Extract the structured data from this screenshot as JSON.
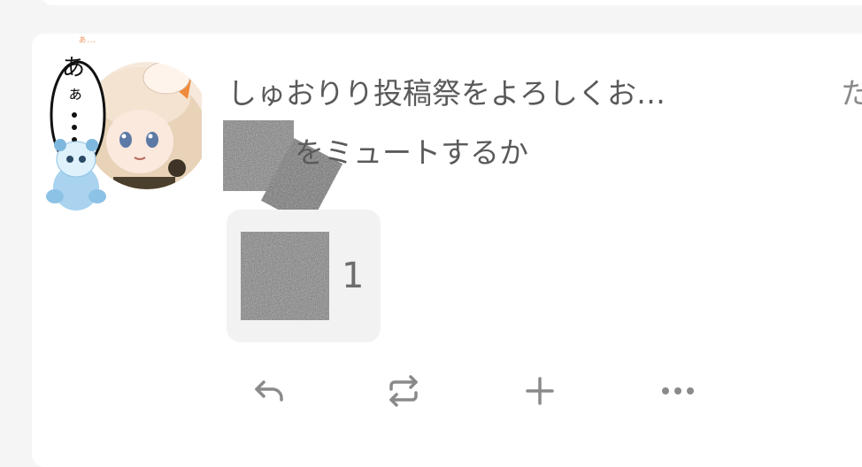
{
  "note": {
    "user": {
      "name": "しゅおりり投稿祭をよろしくお…",
      "handle_partial": "た"
    },
    "text": "をミュートするか",
    "reactions": [
      {
        "count": "1"
      }
    ],
    "footer": {
      "reply": "reply-icon",
      "renote": "repeat-icon",
      "react": "plus-icon",
      "more": "more-icon"
    }
  },
  "colors": {
    "text": "#5a5a5a",
    "icon": "#8a8a8a",
    "reaction_bg": "#f2f2f2",
    "card_bg": "#ffffff",
    "page_bg": "#f5f5f5"
  }
}
